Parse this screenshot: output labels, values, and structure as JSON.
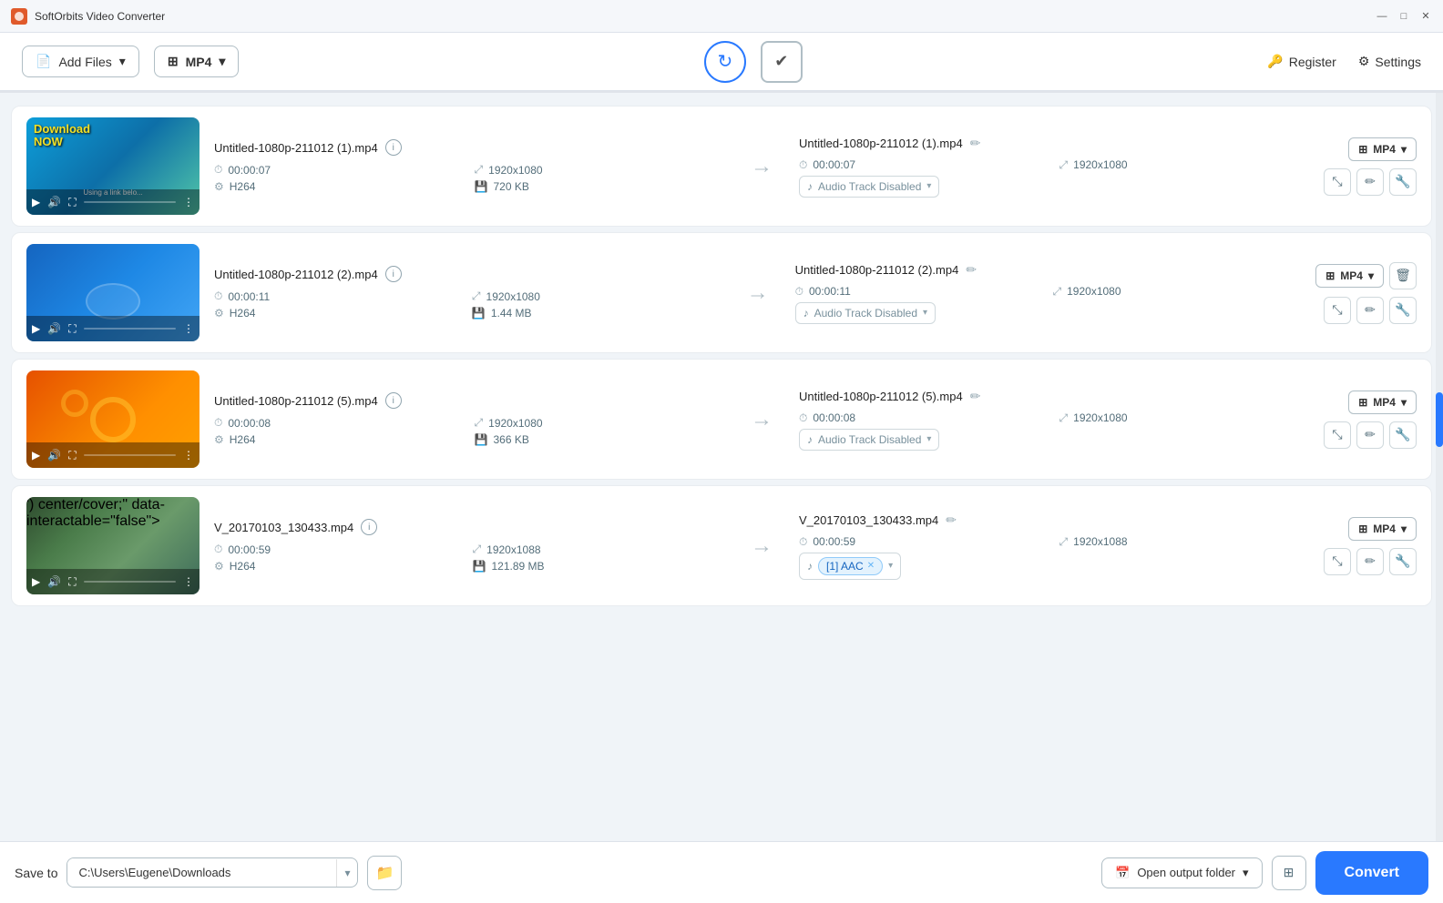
{
  "app": {
    "title": "SoftOrbits Video Converter"
  },
  "titlebar": {
    "minimize": "—",
    "maximize": "□",
    "close": "✕"
  },
  "toolbar": {
    "add_files": "Add Files",
    "format": "MP4",
    "register": "Register",
    "settings": "Settings"
  },
  "files": [
    {
      "id": 1,
      "input_name": "Untitled-1080p-211012 (1).mp4",
      "duration": "00:00:07",
      "resolution": "1920x1080",
      "codec": "H264",
      "size": "720 KB",
      "output_name": "Untitled-1080p-211012 (1).mp4",
      "out_duration": "00:00:07",
      "out_resolution": "1920x1080",
      "audio": "Audio Track Disabled",
      "has_audio_tag": false,
      "format": "MP4",
      "thumb_class": "thumb-inner-1"
    },
    {
      "id": 2,
      "input_name": "Untitled-1080p-211012 (2).mp4",
      "duration": "00:00:11",
      "resolution": "1920x1080",
      "codec": "H264",
      "size": "1.44 MB",
      "output_name": "Untitled-1080p-211012 (2).mp4",
      "out_duration": "00:00:11",
      "out_resolution": "1920x1080",
      "audio": "Audio Track Disabled",
      "has_audio_tag": false,
      "format": "MP4",
      "thumb_class": "thumb-inner-2"
    },
    {
      "id": 3,
      "input_name": "Untitled-1080p-211012 (5).mp4",
      "duration": "00:00:08",
      "resolution": "1920x1080",
      "codec": "H264",
      "size": "366 KB",
      "output_name": "Untitled-1080p-211012 (5).mp4",
      "out_duration": "00:00:08",
      "out_resolution": "1920x1080",
      "audio": "Audio Track Disabled",
      "has_audio_tag": false,
      "format": "MP4",
      "thumb_class": "thumb-inner-3"
    },
    {
      "id": 4,
      "input_name": "V_20170103_130433.mp4",
      "duration": "00:00:59",
      "resolution": "1920x1088",
      "codec": "H264",
      "size": "121.89 MB",
      "output_name": "V_20170103_130433.mp4",
      "out_duration": "00:00:59",
      "out_resolution": "1920x1088",
      "audio": "[1] AAC",
      "has_audio_tag": true,
      "format": "MP4",
      "thumb_class": "thumb-inner-4"
    }
  ],
  "bottom": {
    "save_to_label": "Save to",
    "save_path": "C:\\Users\\Eugene\\Downloads",
    "output_folder_label": "Open output folder",
    "convert_label": "Convert"
  }
}
